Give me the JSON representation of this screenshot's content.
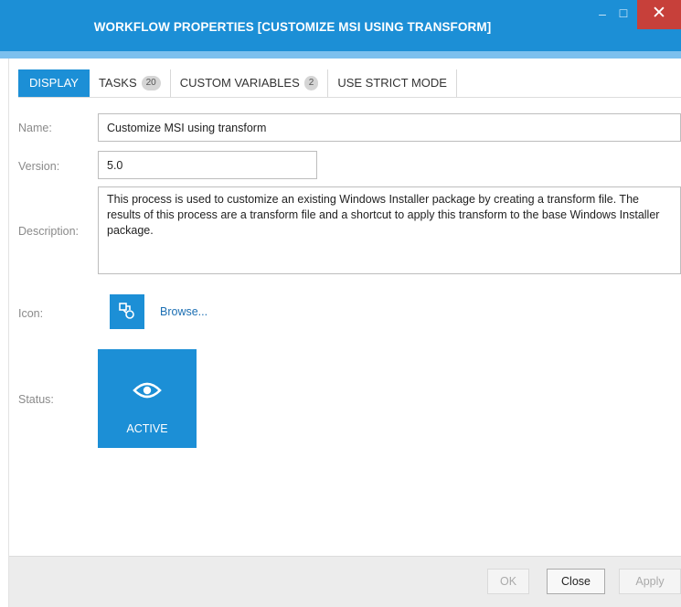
{
  "window": {
    "title": "WORKFLOW PROPERTIES [CUSTOMIZE MSI USING TRANSFORM]",
    "minimize_glyph": "–",
    "maximize_glyph": "☐",
    "close_glyph": "✕"
  },
  "tabs": [
    {
      "label": "DISPLAY",
      "badge": null,
      "active": true
    },
    {
      "label": "TASKS",
      "badge": "20",
      "active": false
    },
    {
      "label": "CUSTOM VARIABLES",
      "badge": "2",
      "active": false
    },
    {
      "label": "USE STRICT MODE",
      "badge": null,
      "active": false
    }
  ],
  "form": {
    "name_label": "Name:",
    "name_value": "Customize MSI using transform",
    "version_label": "Version:",
    "version_value": "5.0",
    "description_label": "Description:",
    "description_value": "This process is used to customize an existing Windows Installer package by creating a transform file.  The results of this process are a transform file and a shortcut to apply this transform to the base Windows Installer package.",
    "icon_label": "Icon:",
    "icon_name": "workflow-shapes-icon",
    "browse_label": "Browse...",
    "status_label": "Status:",
    "status_value": "ACTIVE",
    "status_icon": "eye-icon"
  },
  "footer": {
    "ok_label": "OK",
    "close_label": "Close",
    "apply_label": "Apply"
  },
  "colors": {
    "accent": "#1c8fd6",
    "accent_light": "#7cc0ee",
    "close_button": "#c7403a"
  }
}
